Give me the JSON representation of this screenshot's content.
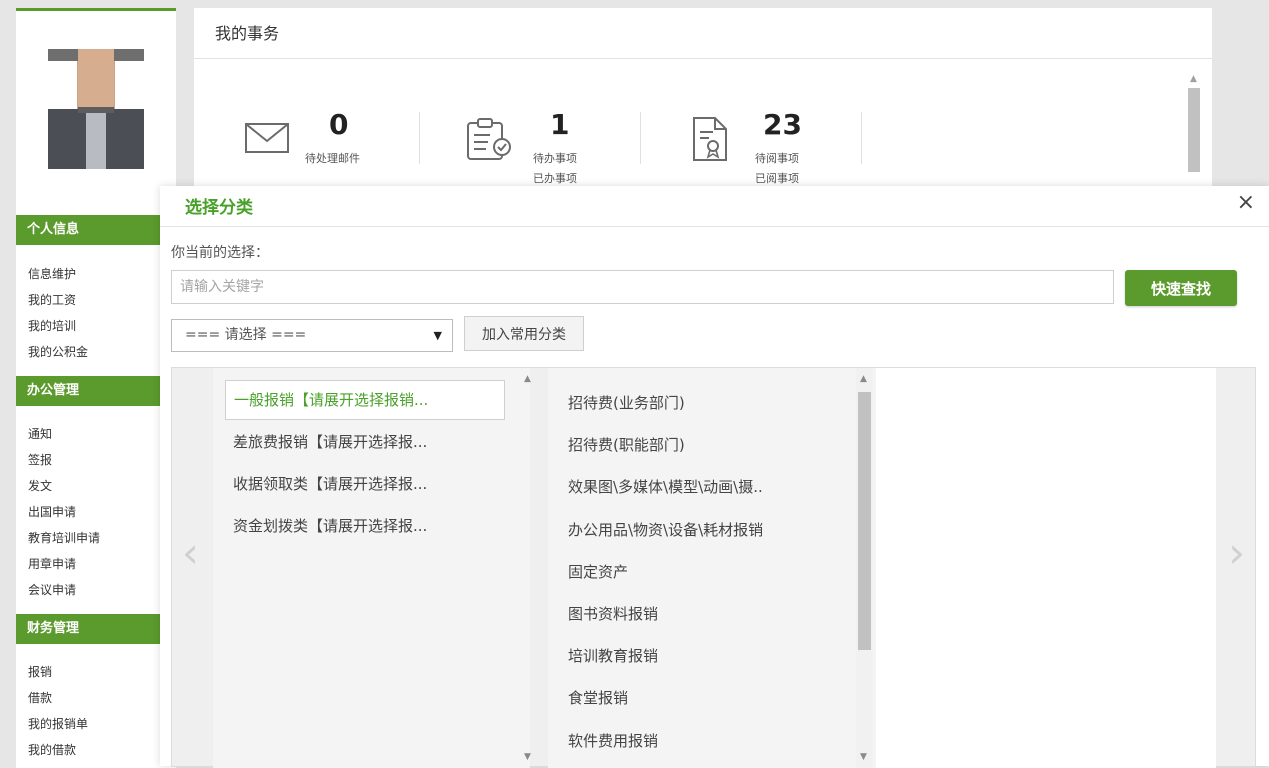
{
  "sidebar": {
    "sections": [
      {
        "title": "个人信息",
        "items": [
          "信息维护",
          "我的工资",
          "我的培训",
          "我的公积金"
        ]
      },
      {
        "title": "办公管理",
        "items": [
          "通知",
          "签报",
          "发文",
          "出国申请",
          "教育培训申请",
          "用章申请",
          "会议申请"
        ]
      },
      {
        "title": "财务管理",
        "items": [
          "报销",
          "借款",
          "我的报销单",
          "我的借款"
        ]
      }
    ]
  },
  "affairs": {
    "title": "我的事务",
    "stats": [
      {
        "icon": "envelope-icon",
        "value": "0",
        "labels": [
          "待处理邮件"
        ]
      },
      {
        "icon": "clipboard-check-icon",
        "value": "1",
        "labels": [
          "待办事项",
          "已办事项"
        ]
      },
      {
        "icon": "certificate-doc-icon",
        "value": "23",
        "labels": [
          "待阅事项",
          "已阅事项"
        ]
      }
    ]
  },
  "modal": {
    "title": "选择分类",
    "close": "×",
    "current_choice_label": "你当前的选择：",
    "search_placeholder": "请输入关键字",
    "quick_find": "快速查找",
    "select_value": "=== 请选择 ===",
    "select_arrow": "▼",
    "add_common": "加入常用分类",
    "prev": "‹",
    "next": "›",
    "col1": [
      "一般报销【请展开选择报销...",
      "差旅费报销【请展开选择报...",
      "收据领取类【请展开选择报...",
      "资金划拨类【请展开选择报..."
    ],
    "col2": [
      "招待费(业务部门)",
      "招待费(职能部门)",
      "效果图\\多媒体\\模型\\动画\\摄..",
      "办公用品\\物资\\设备\\耗材报销",
      "固定资产",
      "图书资料报销",
      "培训教育报销",
      "食堂报销",
      "软件费用报销"
    ]
  },
  "colors": {
    "brand_green": "#5b9a2c",
    "title_green": "#4aa12a"
  }
}
